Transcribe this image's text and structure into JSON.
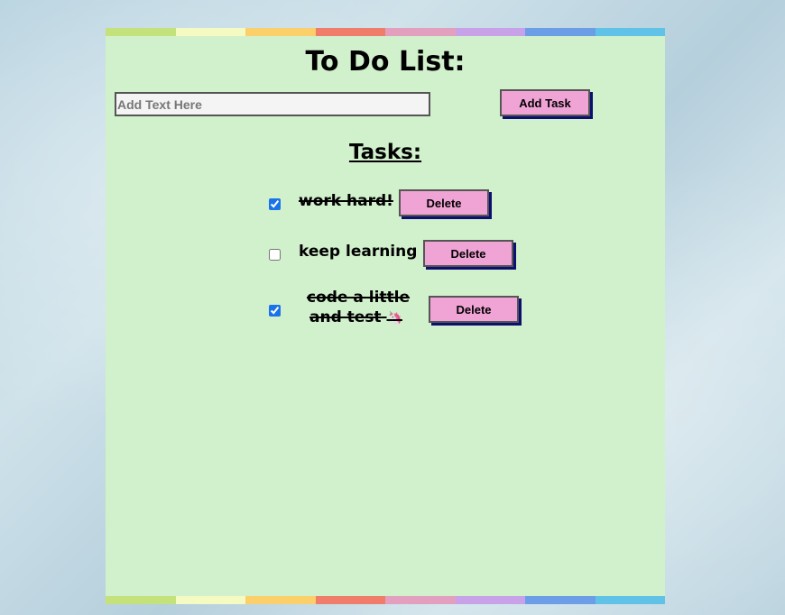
{
  "app": {
    "title": "To Do List:",
    "input_placeholder": "Add Text Here",
    "input_value": "",
    "add_button_label": "Add Task",
    "tasks_heading": "Tasks:"
  },
  "stripe_colors": [
    "#c4e27b",
    "#f5f9c2",
    "#fbd06a",
    "#f07c6a",
    "#e3a0be",
    "#c8a2e8",
    "#6b9ee6",
    "#60c2e6"
  ],
  "tasks": [
    {
      "text": "work hard!",
      "done": true,
      "delete_label": "Delete"
    },
    {
      "text": "keep learning",
      "done": false,
      "delete_label": "Delete"
    },
    {
      "text_line1": "code a little",
      "text_line2": "and test",
      "emoji": "🦄",
      "done": true,
      "delete_label": "Delete"
    }
  ]
}
